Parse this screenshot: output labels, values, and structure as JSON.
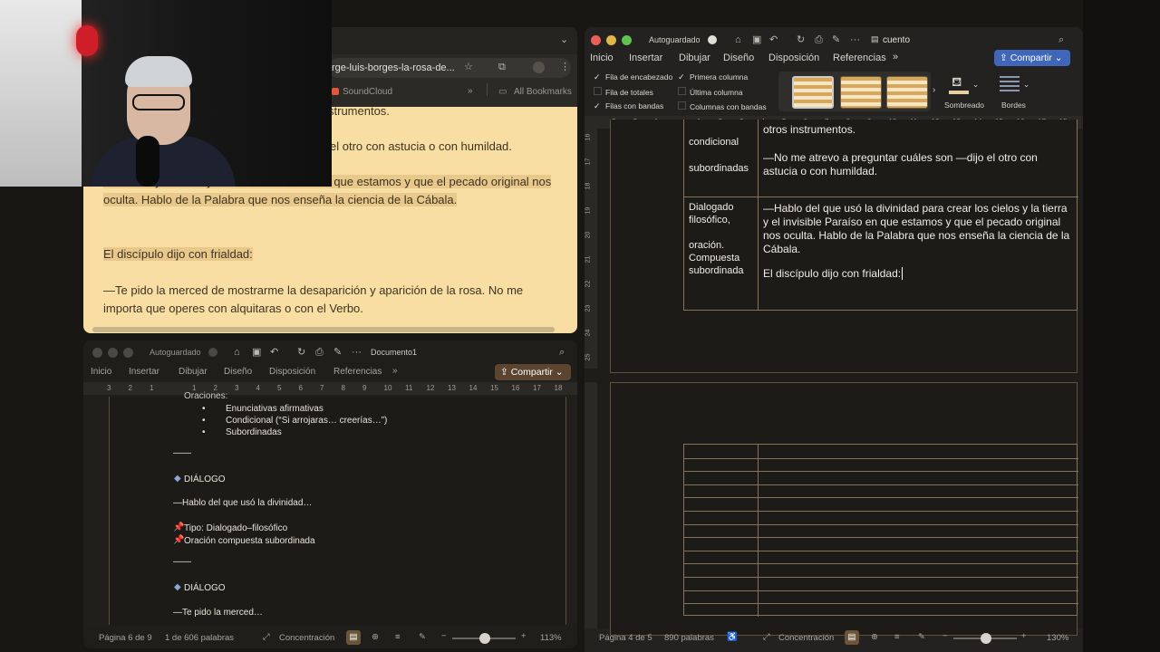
{
  "browser": {
    "address": "rge-luis-borges-la-rosa-de...",
    "bookmarks": {
      "soundcloud": "SoundCloud",
      "all": "All Bookmarks"
    },
    "reader_paragraphs": [
      "strumentos.",
      "el otro con astucia o con humildad.",
      "los cielos y la tierra y el invisible Paraíso en que estamos y que el pecado original nos oculta. Hablo de la Palabra que nos enseña la ciencia de la Cábala.",
      "El discípulo dijo con frialdad:",
      "—Te pido la merced de mostrarme la desaparición y aparición de la rosa. No me importa que operes con alquitaras o con el Verbo."
    ]
  },
  "word_small": {
    "autosave": "Autoguardado",
    "doc_title": "Documento1",
    "menu": [
      "Inicio",
      "Insertar",
      "Dibujar",
      "Diseño",
      "Disposición",
      "Referencias"
    ],
    "share": "Compartir",
    "ruler_numbers": [
      "3",
      "2",
      "1",
      "",
      "1",
      "2",
      "3",
      "4",
      "5",
      "6",
      "7",
      "8",
      "9",
      "10",
      "11",
      "12",
      "13",
      "14",
      "15",
      "16",
      "17",
      "18"
    ],
    "content": {
      "heading_partial": "Oraciones:",
      "bullets": [
        "Enunciativas afirmativas",
        "Condicional (“Si arrojaras… creerías…”)",
        "Subordinadas"
      ],
      "rule1": "——",
      "dialog1_label": "DIÁLOGO",
      "dialog1_quote": "—Hablo del que usó la divinidad…",
      "type_line": "Tipo: Dialogado–filosófico",
      "oracion_line": "Oración compuesta subordinada",
      "rule2": "——",
      "dialog2_label": "DIÁLOGO",
      "dialog2_quote": "—Te pido la merced…"
    },
    "status": {
      "page": "Página 6 de 9",
      "words": "1 de 606 palabras",
      "focus": "Concentración",
      "zoom": "113%"
    }
  },
  "word_big": {
    "autosave": "Autoguardado",
    "doc_title": "cuento",
    "menu": [
      "Inicio",
      "Insertar",
      "Dibujar",
      "Diseño",
      "Disposición",
      "Referencias"
    ],
    "share": "Compartir",
    "options": {
      "header_row": "Fila de encabezado",
      "first_col": "Primera columna",
      "total_row": "Fila de totales",
      "last_col": "Última columna",
      "banded_rows": "Filas con bandas",
      "banded_cols": "Columnas con bandas"
    },
    "shading": "Sombreado",
    "borders": "Bordes",
    "ruler_numbers": [
      "3",
      "2",
      "1",
      "",
      "1",
      "2",
      "3",
      "4",
      "5",
      "6",
      "7",
      "8",
      "9",
      "10",
      "11",
      "12",
      "13",
      "14",
      "15",
      "16",
      "17",
      "18"
    ],
    "vruler_numbers": [
      "16",
      "17",
      "18",
      "19",
      "20",
      "21",
      "22",
      "23",
      "24",
      "25"
    ],
    "table": {
      "row1_left": [
        "condicional",
        "subordinadas"
      ],
      "row1_right_top": "otros instrumentos.",
      "row1_right": "—No me atrevo a preguntar cuáles son —dijo el otro con astucia o con humildad.",
      "row2_left": [
        "Dialogado",
        "filosófico,",
        "",
        "oración.",
        "Compuesta",
        "subordinada"
      ],
      "row2_right": "—Hablo del que usó la divinidad para crear los cielos y la tierra y el invisible Paraíso en que estamos y que el pecado original nos oculta. Hablo de la Palabra que nos enseña la ciencia de la Cábala.",
      "row2_right2": "El discípulo dijo con frialdad:"
    },
    "status": {
      "page": "Página 4 de 5",
      "words": "890 palabras",
      "focus": "Concentración",
      "zoom": "130%"
    }
  },
  "colors": {
    "reader_bg": "#f8dea2",
    "highlight": "#e8c88b",
    "share_blue": "#3f66b8",
    "share_brown": "#5b4530",
    "table_border": "#85735a"
  }
}
